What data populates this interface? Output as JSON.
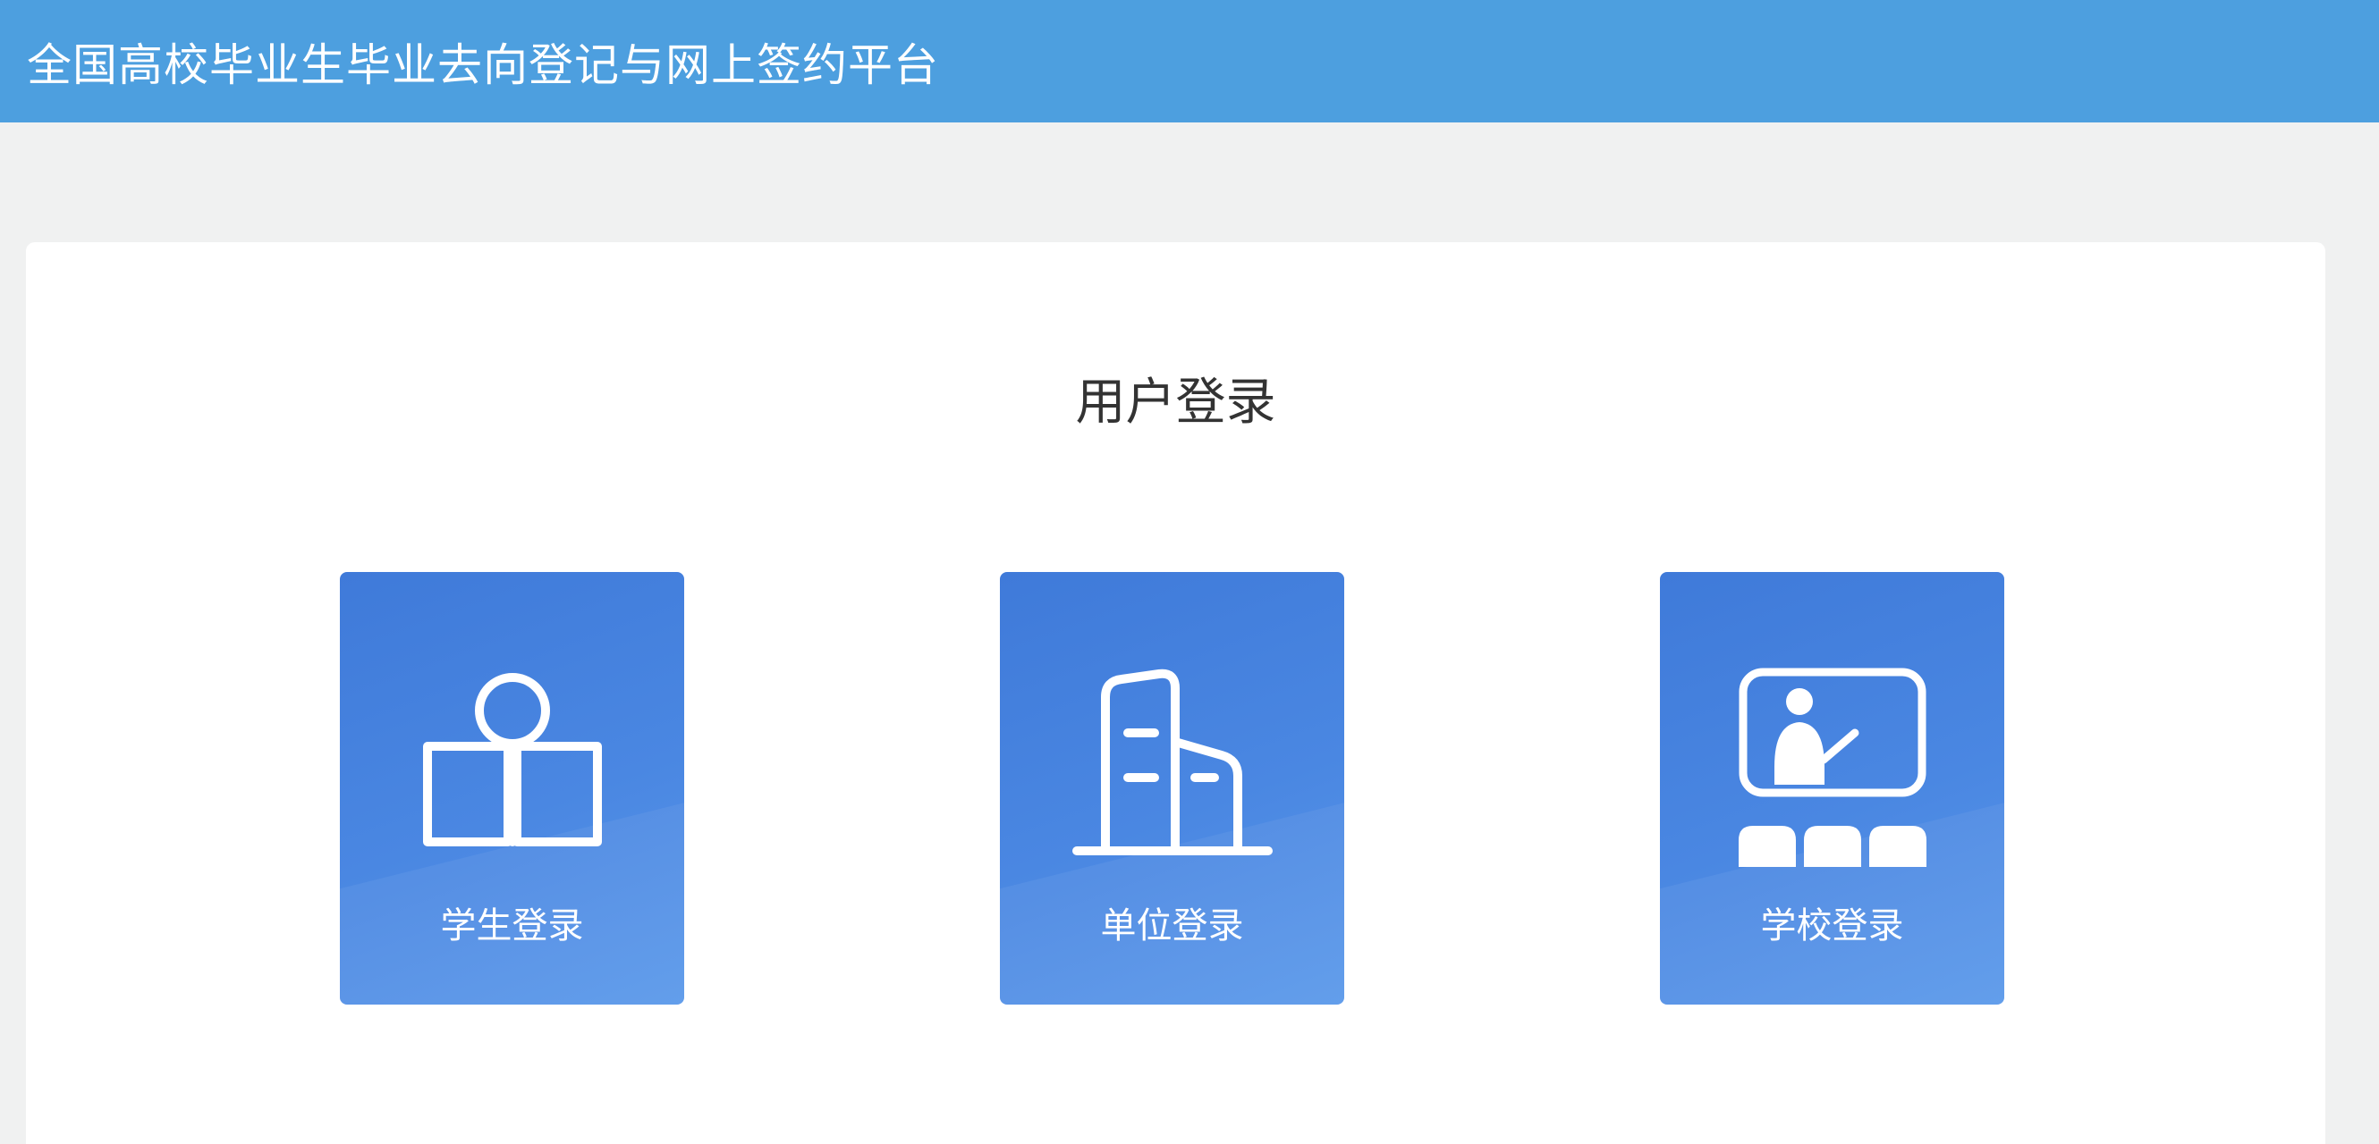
{
  "header": {
    "title": "全国高校毕业生毕业去向登记与网上签约平台",
    "background": "#4d9fdf"
  },
  "login": {
    "title": "用户登录",
    "cards": [
      {
        "label": "学生登录",
        "icon": "student-reading-icon"
      },
      {
        "label": "单位登录",
        "icon": "office-building-icon"
      },
      {
        "label": "学校登录",
        "icon": "teacher-classroom-icon"
      }
    ]
  },
  "colors": {
    "card_blue": "#4a87e2",
    "page_background": "#f0f1f1"
  }
}
